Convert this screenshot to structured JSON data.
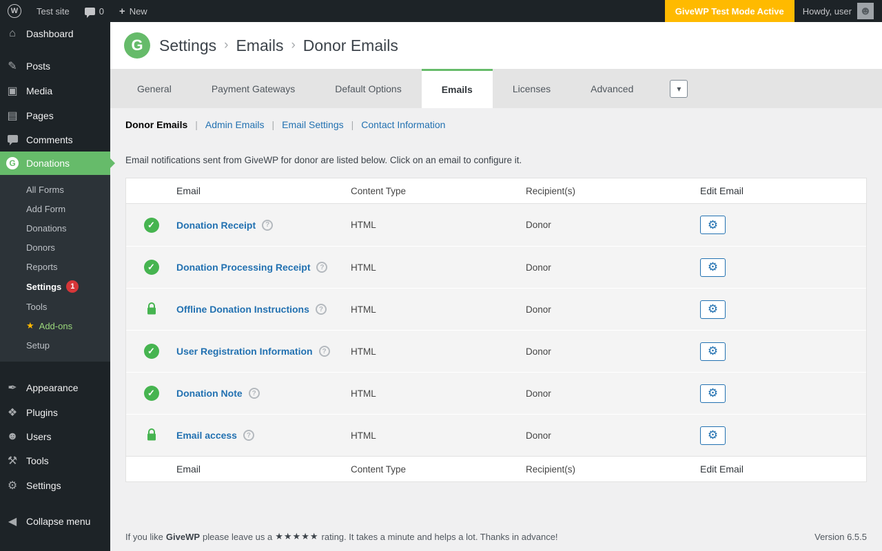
{
  "admin_bar": {
    "site_name": "Test site",
    "comment_count": "0",
    "new_label": "New",
    "test_mode_badge": "GiveWP Test Mode Active",
    "howdy_text": "Howdy, user"
  },
  "sidebar": {
    "items": [
      {
        "label": "Dashboard"
      },
      {
        "label": "Posts"
      },
      {
        "label": "Media"
      },
      {
        "label": "Pages"
      },
      {
        "label": "Comments"
      },
      {
        "label": "Donations"
      }
    ],
    "submenu": [
      {
        "label": "All Forms"
      },
      {
        "label": "Add Form"
      },
      {
        "label": "Donations"
      },
      {
        "label": "Donors"
      },
      {
        "label": "Reports"
      },
      {
        "label": "Settings",
        "badge": "1"
      },
      {
        "label": "Tools"
      },
      {
        "label": "Add-ons"
      },
      {
        "label": "Setup"
      }
    ],
    "lower_items": [
      {
        "label": "Appearance"
      },
      {
        "label": "Plugins"
      },
      {
        "label": "Users"
      },
      {
        "label": "Tools"
      },
      {
        "label": "Settings"
      }
    ],
    "collapse_label": "Collapse menu"
  },
  "header": {
    "breadcrumb": [
      {
        "label": "Settings"
      },
      {
        "label": "Emails"
      },
      {
        "label": "Donor Emails"
      }
    ],
    "separator": "›",
    "logo_letter": "G"
  },
  "tabs": [
    {
      "label": "General"
    },
    {
      "label": "Payment Gateways"
    },
    {
      "label": "Default Options"
    },
    {
      "label": "Emails"
    },
    {
      "label": "Licenses"
    },
    {
      "label": "Advanced"
    }
  ],
  "subnav": {
    "separator": "|",
    "items": [
      {
        "label": "Donor Emails"
      },
      {
        "label": "Admin Emails"
      },
      {
        "label": "Email Settings"
      },
      {
        "label": "Contact Information"
      }
    ]
  },
  "description": "Email notifications sent from GiveWP for donor are listed below. Click on an email to configure it.",
  "table": {
    "headers": {
      "email": "Email",
      "content_type": "Content Type",
      "recipients": "Recipient(s)",
      "edit": "Edit Email"
    },
    "rows": [
      {
        "name": "Donation Receipt",
        "status": "enabled",
        "content_type": "HTML",
        "recipient": "Donor"
      },
      {
        "name": "Donation Processing Receipt",
        "status": "enabled",
        "content_type": "HTML",
        "recipient": "Donor"
      },
      {
        "name": "Offline Donation Instructions",
        "status": "locked",
        "content_type": "HTML",
        "recipient": "Donor"
      },
      {
        "name": "User Registration Information",
        "status": "enabled",
        "content_type": "HTML",
        "recipient": "Donor"
      },
      {
        "name": "Donation Note",
        "status": "enabled",
        "content_type": "HTML",
        "recipient": "Donor"
      },
      {
        "name": "Email access",
        "status": "locked",
        "content_type": "HTML",
        "recipient": "Donor"
      }
    ]
  },
  "footer": {
    "like_prefix": "If you like",
    "brand": "GiveWP",
    "like_mid": "please leave us a",
    "stars": "★★★★★",
    "like_suffix": "rating. It takes a minute and helps a lot. Thanks in advance!",
    "version": "Version 6.5.5"
  },
  "icons": {
    "wp_w": "W",
    "plus": "+",
    "dashboard": "⌂",
    "posts": "✎",
    "media": "▣",
    "pages": "▤",
    "give_g": "G",
    "appearance": "✒",
    "plugins": "❖",
    "users": "☻",
    "tools": "⚒",
    "settings": "⚙",
    "collapse": "◀",
    "avatar_person": "☻",
    "check": "✓",
    "gear": "⚙",
    "help": "?",
    "chevron_down": "▾",
    "star": "★"
  },
  "colors": {
    "accent_green": "#66bb6a",
    "link_blue": "#2271b1",
    "test_mode_orange": "#ffba00",
    "status_green": "#46b450",
    "badge_red": "#d63638"
  }
}
